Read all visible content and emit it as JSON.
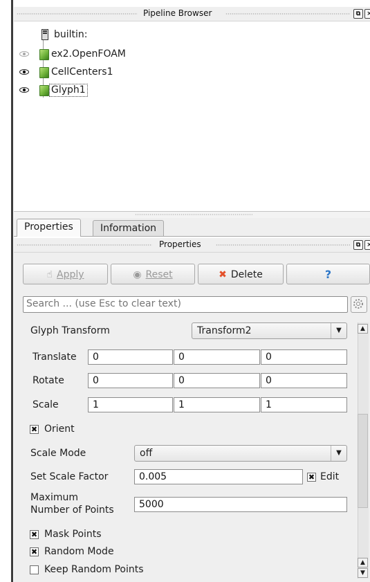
{
  "pipeline_browser": {
    "title": "Pipeline Browser",
    "items": [
      {
        "label": "builtin:",
        "icon": "server-icon"
      },
      {
        "label": "ex2.OpenFOAM",
        "icon": "cube-icon",
        "visible": false
      },
      {
        "label": "CellCenters1",
        "icon": "cube-icon",
        "visible": true
      },
      {
        "label": "Glyph1",
        "icon": "cube-icon",
        "visible": true,
        "selected": true
      }
    ]
  },
  "tabs": [
    "Properties",
    "Information"
  ],
  "properties": {
    "title": "Properties",
    "buttons": {
      "apply": "Apply",
      "reset": "Reset",
      "delete": "Delete",
      "help": "?"
    },
    "search_placeholder": "Search ... (use Esc to clear text)",
    "glyph_transform": {
      "label": "Glyph Transform",
      "value": "Transform2"
    },
    "translate": {
      "label": "Translate",
      "values": [
        "0",
        "0",
        "0"
      ]
    },
    "rotate": {
      "label": "Rotate",
      "values": [
        "0",
        "0",
        "0"
      ]
    },
    "scale": {
      "label": "Scale",
      "values": [
        "1",
        "1",
        "1"
      ]
    },
    "orient": {
      "label": "Orient",
      "checked": true
    },
    "scale_mode": {
      "label": "Scale Mode",
      "value": "off"
    },
    "scale_factor": {
      "label": "Set Scale Factor",
      "value": "0.005",
      "edit_label": "Edit",
      "edit_checked": true
    },
    "max_points": {
      "label_line1": "Maximum",
      "label_line2": "Number of Points",
      "value": "5000"
    },
    "mask_points": {
      "label": "Mask Points",
      "checked": true
    },
    "random_mode": {
      "label": "Random Mode",
      "checked": true
    },
    "keep_random": {
      "label": "Keep Random Points",
      "checked": false
    }
  },
  "colors": {
    "delete_icon": "#e3502a",
    "help_icon": "#2f78c8",
    "cube": "#6fb33a"
  }
}
